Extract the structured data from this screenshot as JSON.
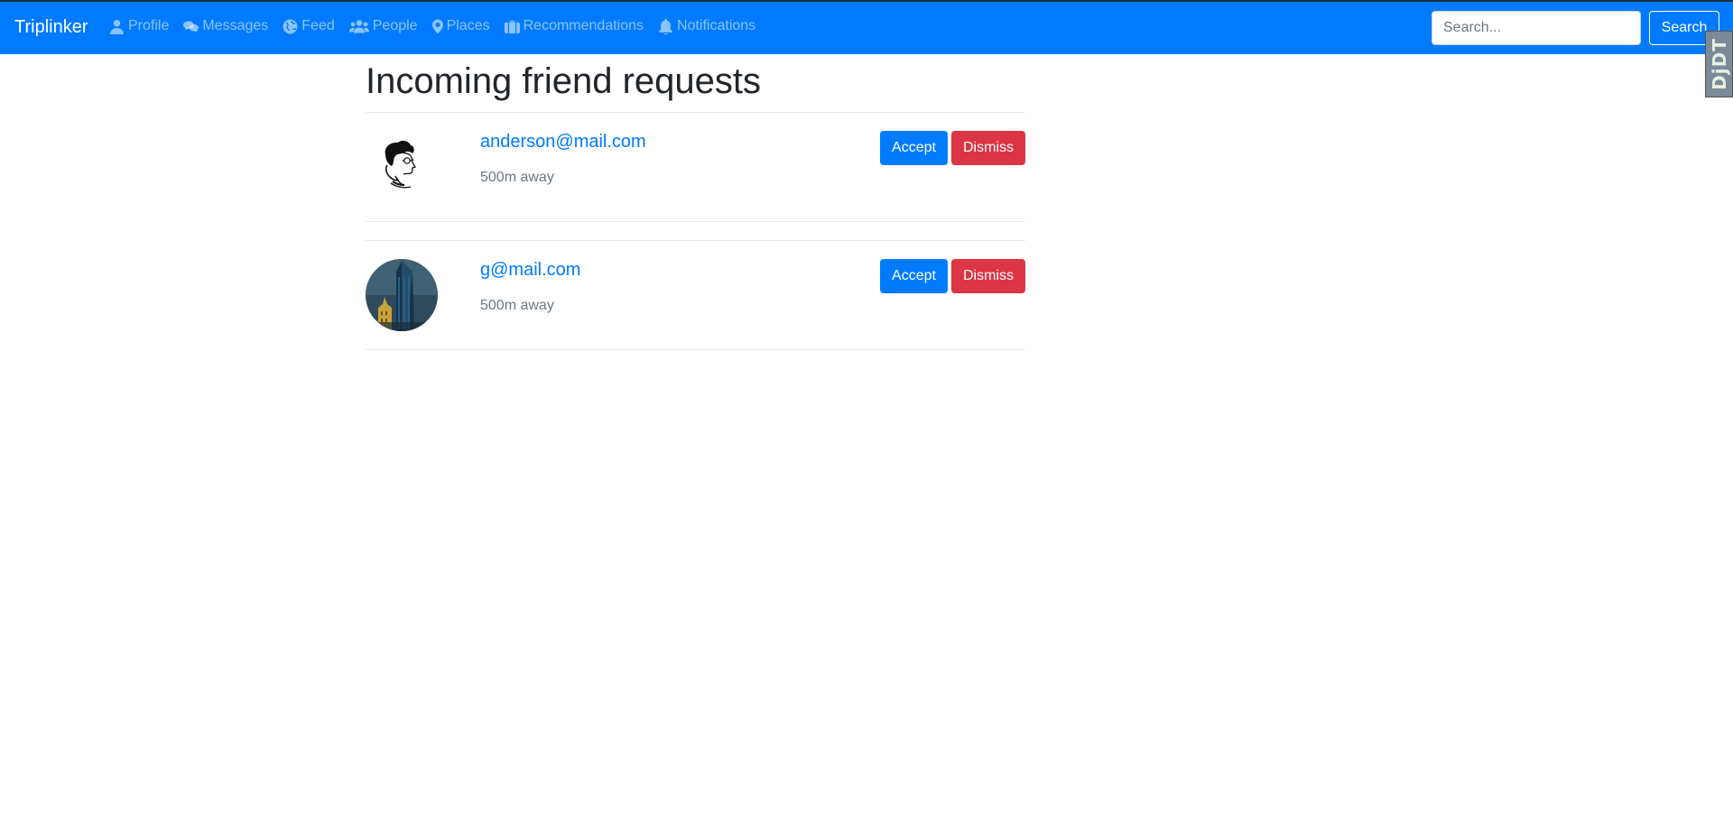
{
  "navbar": {
    "brand": "Triplinker",
    "items": [
      {
        "label": "Profile",
        "icon": "user-icon"
      },
      {
        "label": "Messages",
        "icon": "comments-icon"
      },
      {
        "label": "Feed",
        "icon": "globe-icon"
      },
      {
        "label": "People",
        "icon": "users-icon"
      },
      {
        "label": "Places",
        "icon": "map-marker-icon"
      },
      {
        "label": "Recommendations",
        "icon": "suitcase-icon"
      },
      {
        "label": "Notifications",
        "icon": "bell-icon"
      }
    ],
    "search_placeholder": "Search...",
    "search_button": "Search"
  },
  "debug_toolbar": {
    "label": "DjDT"
  },
  "page": {
    "heading": "Incoming friend requests",
    "requests": [
      {
        "email": "anderson@mail.com",
        "distance": "500m away",
        "accept_label": "Accept",
        "dismiss_label": "Dismiss"
      },
      {
        "email": "g@mail.com",
        "distance": "500m away",
        "accept_label": "Accept",
        "dismiss_label": "Dismiss"
      }
    ]
  },
  "colors": {
    "navbar": "#007bff",
    "accept": "#007bff",
    "dismiss": "#dc3545",
    "link": "#007bff",
    "muted": "#6c757d"
  }
}
